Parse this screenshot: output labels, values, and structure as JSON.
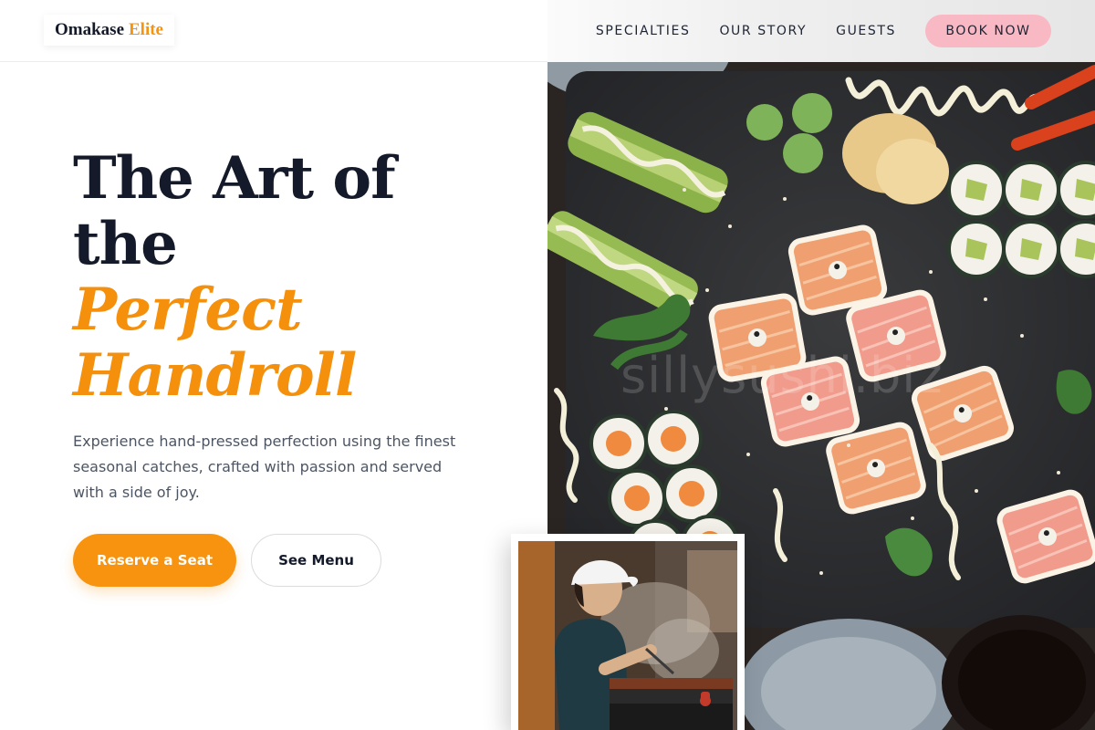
{
  "brand": {
    "name_main": "Omakase",
    "name_accent": "Elite"
  },
  "nav": {
    "items": [
      "SPECIALTIES",
      "OUR STORY",
      "GUESTS"
    ],
    "cta_label": "BOOK NOW"
  },
  "hero": {
    "title_line_1": "The Art of",
    "title_line_2": "the",
    "title_accent_1": "Perfect",
    "title_accent_2": "Handroll",
    "description": "Experience hand-pressed perfection using the finest seasonal catches, crafted with passion and served with a side of joy.",
    "primary_button": "Reserve a Seat",
    "secondary_button": "See Menu"
  },
  "images": {
    "watermark": "sillysushi.biz"
  },
  "colors": {
    "accent": "#f5940f",
    "book_button": "#f8b9c4",
    "heading": "#141a2a",
    "body_text": "#4d5563"
  }
}
